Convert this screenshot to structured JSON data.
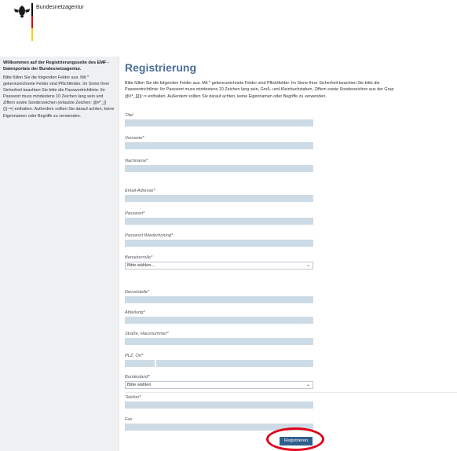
{
  "header": {
    "brand": "Bundesnetzagentur",
    "colors": {
      "black": "#000000",
      "red": "#dd0000",
      "gold": "#ffce00"
    }
  },
  "sidebar": {
    "title": "Willkommen auf der Registrierungsseite des EMF - Datenportals der Bundesnetzagentur.",
    "text": "Bitte füllen Sie die folgenden Felder aus. Mit * gekennzeichnete Felder sind Pflichtfelder. Im Sinne Ihrer Sicherheit beachten Sie bitte die Passwortrichtlinie: Ihr Passwort muss mindestens 10 Zeichen lang sein und Ziffern sowie Sonderzeichen (erlaubte Zeichen: @#*_[]{}|~=) enthalten. Außerdem sollten Sie darauf achten, keine Eigennamen oder Begriffe zu verwenden."
  },
  "main": {
    "title": "Registrierung",
    "intro_line1": "Bitte füllen Sie die folgenden Felder aus. Mit * gekennzeichnete Felder sind Pflichtfelder. Im Sinne Ihrer Sicherheit beachten Sie bitte die",
    "intro_line2": "Passwortrichtlinie: Ihr Passwort muss mindestens 10 Zeichen lang sein, Groß- und Kleinbuchstaben, Ziffern sowie Sonderzeichen aus der Grup",
    "intro_line3": "@#*_[]{}|~= enthalten. Außerdem sollten Sie darauf achten, keine Eigennamen oder Begriffe zu verwenden."
  },
  "form": {
    "titel": "Titel",
    "vorname": "Vorname*",
    "nachname": "Nachname*",
    "email": "Email-Adresse*",
    "passwort": "Passwort*",
    "passwort_wdh": "Passwort Wiederholung*",
    "benutzerrolle": "Benutzerrolle*",
    "benutzerrolle_value": "Bitte wählen...",
    "dienststelle": "Dienststelle*",
    "abteilung": "Abteilung*",
    "strasse": "Straße, Hausnummer*",
    "plz_ort": "PLZ, Ort*",
    "bundesland": "Bundesland*",
    "bundesland_value": "Bitte wählen",
    "telefon": "Telefon*",
    "fax": "Fax",
    "submit": "Registrieren"
  },
  "icons": {
    "dropdown": "chevron-down-icon",
    "logo": "federal-eagle-icon"
  },
  "highlight_color": "#e0001b"
}
